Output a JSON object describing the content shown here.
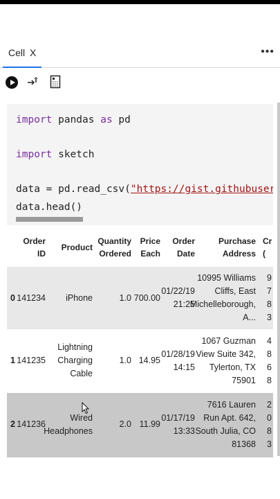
{
  "tab": {
    "label": "Cell",
    "close": "X"
  },
  "toolbar": {
    "more": "•••"
  },
  "code": {
    "line1": {
      "kw1": "import",
      "mid": " pandas ",
      "kw2": "as",
      "rest": " pd"
    },
    "line2": {
      "kw1": "import",
      "rest": " sketch"
    },
    "line3": {
      "pre": "data = pd.read_csv(",
      "str": "\"https://gist.githubusercontent.c"
    },
    "line4": "data.head()"
  },
  "table": {
    "headers": {
      "order_id": [
        "Order",
        "ID"
      ],
      "product": "Product",
      "qty": [
        "Quantity",
        "Ordered"
      ],
      "price": [
        "Price",
        "Each"
      ],
      "date": [
        "Order",
        "Date"
      ],
      "address": [
        "Purchase",
        "Address"
      ],
      "cr": [
        "Cr",
        "("
      ]
    },
    "rows": [
      {
        "index": "0",
        "order_id": "141234",
        "product": [
          "iPhone"
        ],
        "qty": "1.0",
        "price": "700.00",
        "date": [
          "01/22/19",
          "21:25"
        ],
        "address": [
          "10995 Williams",
          "Cliffs, East",
          "Michelleborough,",
          "A..."
        ],
        "cr": [
          "9",
          "7",
          "8",
          "3"
        ]
      },
      {
        "index": "1",
        "order_id": "141235",
        "product": [
          "Lightning",
          "Charging",
          "Cable"
        ],
        "qty": "1.0",
        "price": "14.95",
        "date": [
          "01/28/19",
          "14:15"
        ],
        "address": [
          "1067 Guzman",
          "View Suite 342,",
          "Tylerton, TX",
          "75901"
        ],
        "cr": [
          "4",
          "8",
          "6",
          "8"
        ]
      },
      {
        "index": "2",
        "order_id": "141236",
        "product": [
          "Wired",
          "Headphones"
        ],
        "qty": "2.0",
        "price": "11.99",
        "date": [
          "01/17/19",
          "13:33"
        ],
        "address": [
          "7616 Lauren",
          "Run Apt. 642,",
          "South Julia, CO",
          "81368"
        ],
        "cr": [
          "2",
          "0",
          "8",
          "3"
        ]
      }
    ]
  }
}
